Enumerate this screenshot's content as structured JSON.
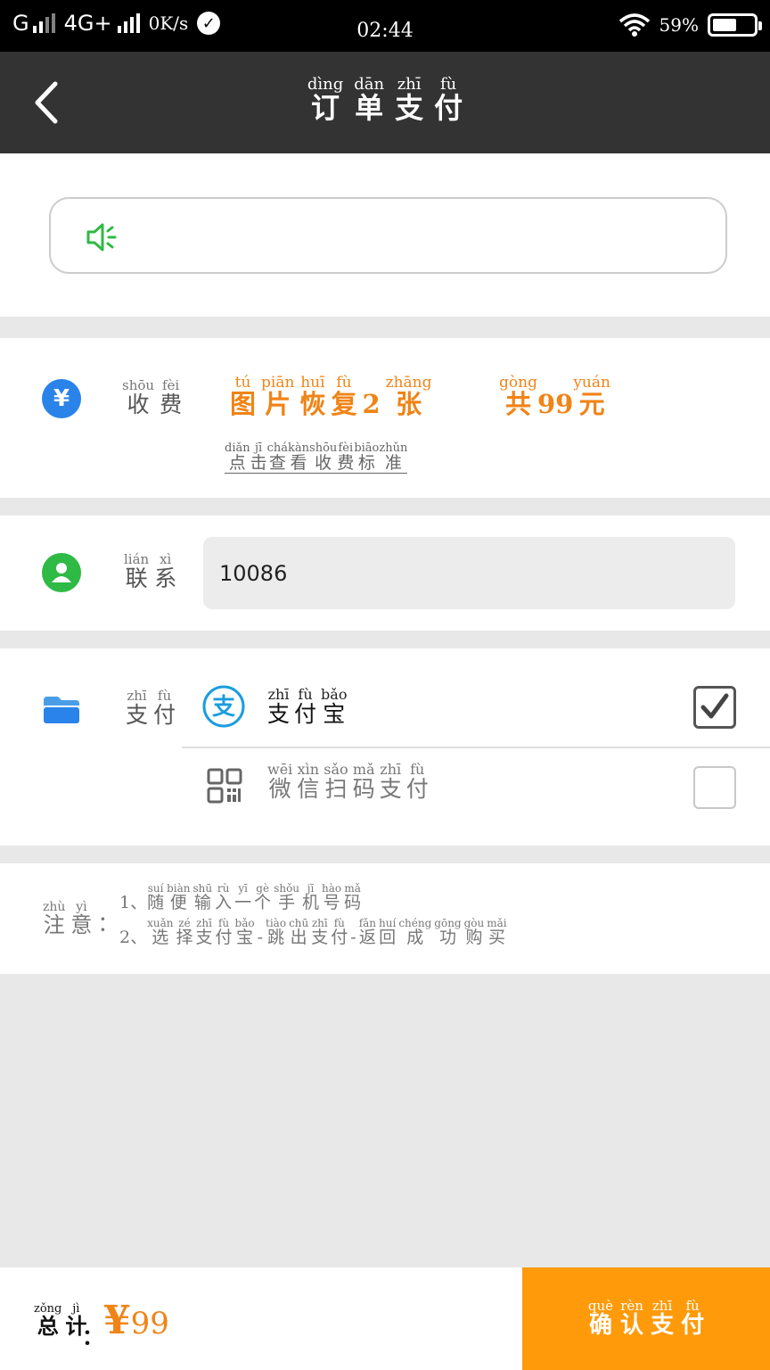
{
  "status_bar": {
    "network": "G",
    "network2": "4G+",
    "speed": "0K/s",
    "time": "02:44",
    "battery": "59%",
    "battery_level": 0.59
  },
  "header": {
    "title": [
      {
        "py": "dìng",
        "hz": "订"
      },
      {
        "py": "dān",
        "hz": "单"
      },
      {
        "py": "zhī",
        "hz": "支"
      },
      {
        "py": "fù",
        "hz": "付"
      }
    ]
  },
  "fee": {
    "label": [
      {
        "py": "shōu",
        "hz": "收"
      },
      {
        "py": "fèi",
        "hz": "费"
      }
    ],
    "item": [
      {
        "py": "tú",
        "hz": "图"
      },
      {
        "py": "piān",
        "hz": "片"
      },
      {
        "py": "huī",
        "hz": "恢"
      },
      {
        "py": "fù",
        "hz": "复"
      },
      {
        "py": "",
        "hz": "2"
      },
      {
        "py": "zhāng",
        "hz": "张"
      }
    ],
    "total": [
      {
        "py": "gòng",
        "hz": "共"
      },
      {
        "py": "",
        "hz": "99"
      },
      {
        "py": "yuán",
        "hz": "元"
      }
    ],
    "link": [
      {
        "py": "diǎn",
        "hz": "点"
      },
      {
        "py": "jī",
        "hz": "击"
      },
      {
        "py": "chá",
        "hz": "查"
      },
      {
        "py": "kàn",
        "hz": "看"
      },
      {
        "py": "shōu",
        "hz": "收"
      },
      {
        "py": "fèi",
        "hz": "费"
      },
      {
        "py": "biāo",
        "hz": "标"
      },
      {
        "py": "zhǔn",
        "hz": "准"
      }
    ]
  },
  "contact": {
    "label": [
      {
        "py": "lián",
        "hz": "联"
      },
      {
        "py": "xì",
        "hz": "系"
      }
    ],
    "phone_value": "10086"
  },
  "payment": {
    "label": [
      {
        "py": "zhī",
        "hz": "支"
      },
      {
        "py": "fù",
        "hz": "付"
      }
    ],
    "options": [
      {
        "name": [
          {
            "py": "zhī",
            "hz": "支"
          },
          {
            "py": "fù",
            "hz": "付"
          },
          {
            "py": "bǎo",
            "hz": "宝"
          }
        ],
        "checked": true
      },
      {
        "name": [
          {
            "py": "wēi",
            "hz": "微"
          },
          {
            "py": "xìn",
            "hz": "信"
          },
          {
            "py": "sǎo",
            "hz": "扫"
          },
          {
            "py": "mǎ",
            "hz": "码"
          },
          {
            "py": "zhī",
            "hz": "支"
          },
          {
            "py": "fù",
            "hz": "付"
          }
        ],
        "checked": false
      }
    ]
  },
  "note": {
    "title": [
      {
        "py": "zhù",
        "hz": "注"
      },
      {
        "py": "yì",
        "hz": "意"
      }
    ],
    "colon": "：",
    "line1_prefix": "1、",
    "line1": [
      {
        "py": "suí",
        "hz": "随"
      },
      {
        "py": "biàn",
        "hz": "便"
      },
      {
        "py": "shū",
        "hz": "输"
      },
      {
        "py": "rù",
        "hz": "入"
      },
      {
        "py": "yī",
        "hz": "一"
      },
      {
        "py": "gè",
        "hz": "个"
      },
      {
        "py": "shǒu",
        "hz": "手"
      },
      {
        "py": "jī",
        "hz": "机"
      },
      {
        "py": "hào",
        "hz": "号"
      },
      {
        "py": "mǎ",
        "hz": "码"
      }
    ],
    "line2_prefix": "2、",
    "line2": [
      {
        "py": "xuǎn",
        "hz": "选"
      },
      {
        "py": "zé",
        "hz": "择"
      },
      {
        "py": "zhī",
        "hz": "支"
      },
      {
        "py": "fù",
        "hz": "付"
      },
      {
        "py": "bǎo",
        "hz": "宝"
      },
      {
        "py": "",
        "hz": "-"
      },
      {
        "py": "tiào",
        "hz": "跳"
      },
      {
        "py": "chū",
        "hz": "出"
      },
      {
        "py": "zhī",
        "hz": "支"
      },
      {
        "py": "fù",
        "hz": "付"
      },
      {
        "py": "",
        "hz": "-"
      },
      {
        "py": "fǎn",
        "hz": "返"
      },
      {
        "py": "huí",
        "hz": "回"
      },
      {
        "py": "chéng",
        "hz": "成"
      },
      {
        "py": "gōng",
        "hz": "功"
      },
      {
        "py": "gòu",
        "hz": "购"
      },
      {
        "py": "mǎi",
        "hz": "买"
      }
    ]
  },
  "footer": {
    "total_label": [
      {
        "py": "zǒng",
        "hz": "总"
      },
      {
        "py": "jì",
        "hz": "计"
      }
    ],
    "colon": "：",
    "currency": "¥",
    "amount": "99",
    "confirm": [
      {
        "py": "què",
        "hz": "确"
      },
      {
        "py": "rèn",
        "hz": "认"
      },
      {
        "py": "zhī",
        "hz": "支"
      },
      {
        "py": "fù",
        "hz": "付"
      }
    ]
  },
  "colors": {
    "accent": "#ff9a0a",
    "price": "#f08417",
    "header_bg": "#333333",
    "alipay_blue": "#1a9de0",
    "icon_green": "#2fb945",
    "icon_blue": "#2a83e9"
  },
  "icons": [
    "back-arrow-icon",
    "speaker-icon",
    "yen-icon",
    "user-icon",
    "card-icon",
    "alipay-icon",
    "qrcode-icon",
    "checkmark-icon"
  ]
}
